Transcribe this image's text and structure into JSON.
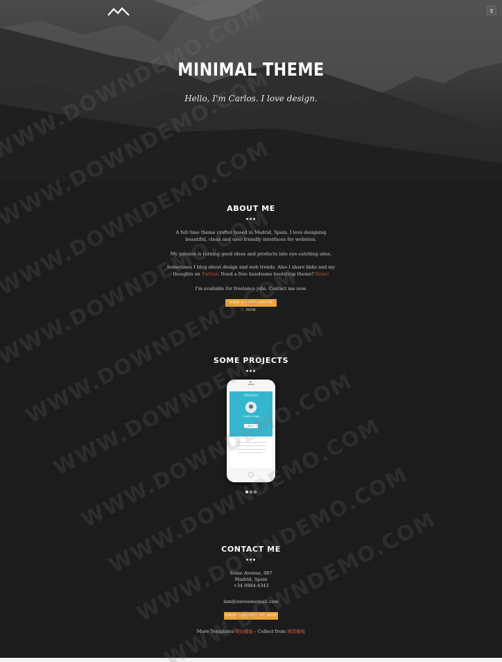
{
  "hero": {
    "title": "MINIMAL THEME",
    "subtitle": "Hello, I'm Carlos. I love design."
  },
  "about": {
    "title": "ABOUT ME",
    "p1_line1": "A full time theme crafter based in Madrid, Spain. I love designing",
    "p1_line2": "beautiful, clean and user-friendly interfaces for websites.",
    "p2": "My passion is turning good ideas and products into eye-catching sites.",
    "p3_line1": "Sometimes I blog about design and web trends. Also I share links and my",
    "p3_pre": "thoughts on ",
    "p3_link1": "Twitter",
    "p3_mid": ". Need a free handsome bootstrap theme? ",
    "p3_link2": "Done!",
    "p4": "I'm available for freelance jobs. Contact me now.",
    "button": "HIRE A FREELANCER NOW"
  },
  "projects": {
    "title": "SOME PROJECTS",
    "app_name": "iShapes",
    "user_name": "Carlos Ling",
    "app_button": "Next",
    "active_slide": 1,
    "slide_count": 3
  },
  "contact": {
    "title": "CONTACT ME",
    "address1": "Some Avenue, 987",
    "address2": "Madrid, Spain",
    "phone": "+34 8984-4343",
    "email": "lam@awesomemail.com",
    "button": "DROP CONTACT ME NOW"
  },
  "footer": {
    "pre": "More Templates ",
    "link1": "网站模板",
    "mid": " - Collect from ",
    "link2": "网页模板"
  },
  "watermark": "WWW.DOWNDEMO.COM",
  "colors": {
    "accent": "#d0543a",
    "button": "#e9a43a",
    "background": "#1c1c1d",
    "app_screen": "#35b6cf"
  }
}
